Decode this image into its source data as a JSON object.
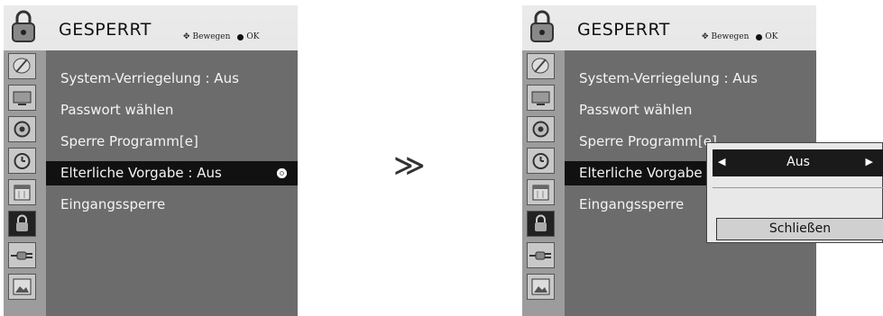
{
  "arrow": "≫",
  "menu": {
    "title": "GESPERRT",
    "hint_move": "Bewegen",
    "hint_ok": "OK",
    "items": [
      "System-Verriegelung : Aus",
      "Passwort wählen",
      "Sperre Programm[e]",
      "Elterliche Vorgabe  : Aus",
      "Eingangssperre"
    ],
    "items_right": [
      "System-Verriegelung : Aus",
      "Passwort wählen",
      "Sperre Programm[e]",
      "Elterliche Vorgabe",
      "Eingangssperre"
    ],
    "selected_index": 3
  },
  "sidebar_icons": [
    "satellite-icon",
    "screen-icon",
    "speaker-icon",
    "clock-icon",
    "calendar-icon",
    "lock-icon",
    "plug-icon",
    "photo-icon"
  ],
  "sidebar_active": "lock-icon",
  "popup": {
    "value": "Aus",
    "close_label": "Schließen"
  },
  "colors": {
    "panel": "#6c6c6c",
    "sidebar": "#9c9c9c",
    "selected": "#111111"
  }
}
